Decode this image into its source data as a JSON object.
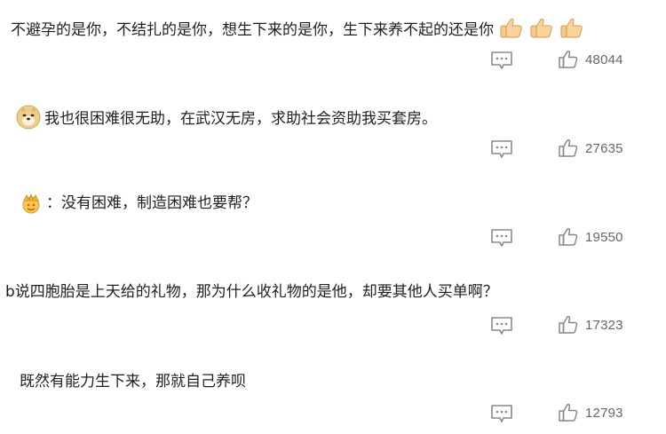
{
  "comments": [
    {
      "text": "不避孕的是你，不结扎的是你，想生下来的是你，生下来养不起的还是你",
      "trailing_emojis": [
        "thumbs-up-emoji",
        "thumbs-up-emoji",
        "thumbs-up-emoji"
      ],
      "reply_icon": "comment-bubble-icon",
      "like_icon": "thumbs-up-outline-icon",
      "likes": "48044"
    },
    {
      "leading_emoji": "doge-emoji",
      "text": "我也很困难很无助，在武汉无房，求助社会资助我买套房。",
      "reply_icon": "comment-bubble-icon",
      "like_icon": "thumbs-up-outline-icon",
      "likes": "27635"
    },
    {
      "leading_emoji": "crown-badge-icon",
      "text": "：没有困难，制造困难也要帮？",
      "reply_icon": "comment-bubble-icon",
      "like_icon": "thumbs-up-outline-icon",
      "likes": "19550"
    },
    {
      "text": "b说四胞胎是上天给的礼物，那为什么收礼物的是他，却要其他人买单啊？",
      "reply_icon": "comment-bubble-icon",
      "like_icon": "thumbs-up-outline-icon",
      "likes": "17323"
    },
    {
      "text": "既然有能力生下来，那就自己养呗",
      "reply_icon": "comment-bubble-icon",
      "like_icon": "thumbs-up-outline-icon",
      "likes": "12793"
    }
  ],
  "colors": {
    "text": "#1f1f1f",
    "icon": "#888888",
    "count": "#666666",
    "thumb_emoji": "#f2c27a"
  }
}
